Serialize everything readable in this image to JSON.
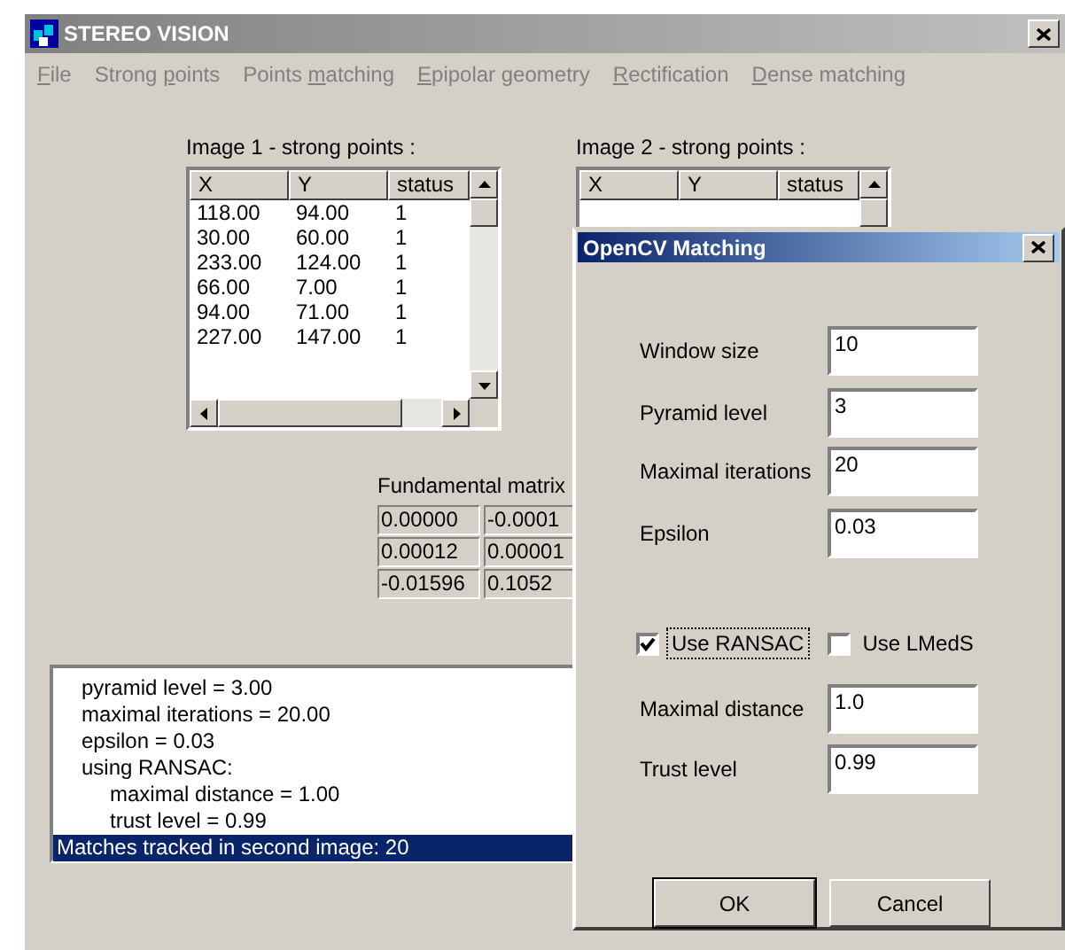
{
  "window": {
    "title": "STEREO VISION"
  },
  "menu": [
    {
      "key": "F",
      "after": "ile"
    },
    {
      "before": "Strong ",
      "key": "p",
      "after": "oints"
    },
    {
      "before": "Points ",
      "key": "m",
      "after": "atching"
    },
    {
      "key": "E",
      "after": "pipolar geometry"
    },
    {
      "key": "R",
      "after": "ectification"
    },
    {
      "key": "D",
      "after": "ense matching"
    }
  ],
  "image1_points": {
    "label": "Image 1 - strong points :",
    "columns": [
      "X",
      "Y",
      "status"
    ],
    "rows": [
      [
        "118.00",
        "94.00",
        "1"
      ],
      [
        "30.00",
        "60.00",
        "1"
      ],
      [
        "233.00",
        "124.00",
        "1"
      ],
      [
        "66.00",
        "7.00",
        "1"
      ],
      [
        "94.00",
        "71.00",
        "1"
      ],
      [
        "227.00",
        "147.00",
        "1"
      ]
    ]
  },
  "image2_points": {
    "label": "Image 2 - strong points :",
    "columns": [
      "X",
      "Y",
      "status"
    ]
  },
  "fundamental_matrix": {
    "label": "Fundamental matrix",
    "rows": [
      [
        "0.00000",
        "-0.0001"
      ],
      [
        "0.00012",
        "0.00001"
      ],
      [
        "-0.01596",
        "0.1052"
      ]
    ]
  },
  "log": [
    {
      "text": "pyramid level = 3.00",
      "selected": false
    },
    {
      "text": "maximal iterations = 20.00",
      "selected": false
    },
    {
      "text": "epsilon = 0.03",
      "selected": false
    },
    {
      "text": "using RANSAC:",
      "selected": false,
      "children": [
        {
          "text": "maximal distance = 1.00",
          "selected": false
        },
        {
          "text": "trust level = 0.99",
          "selected": false
        }
      ]
    },
    {
      "text": "Matches tracked in second image: 20",
      "selected": true
    }
  ],
  "dialog": {
    "title": "OpenCV Matching",
    "fields": [
      {
        "label": "Window size",
        "value": "10"
      },
      {
        "label": "Pyramid level",
        "value": "3"
      },
      {
        "label": "Maximal iterations",
        "value": "20"
      },
      {
        "label": "Epsilon",
        "value": "0.03"
      }
    ],
    "checkboxes": [
      {
        "label": "Use RANSAC",
        "checked": true,
        "focused": true
      },
      {
        "label": "Use LMedS",
        "checked": false,
        "focused": false
      }
    ],
    "fields2": [
      {
        "label": "Maximal distance",
        "value": "1.0"
      },
      {
        "label": "Trust level",
        "value": "0.99"
      }
    ],
    "buttons": [
      {
        "label": "OK",
        "default": true
      },
      {
        "label": "Cancel",
        "default": false
      }
    ]
  }
}
